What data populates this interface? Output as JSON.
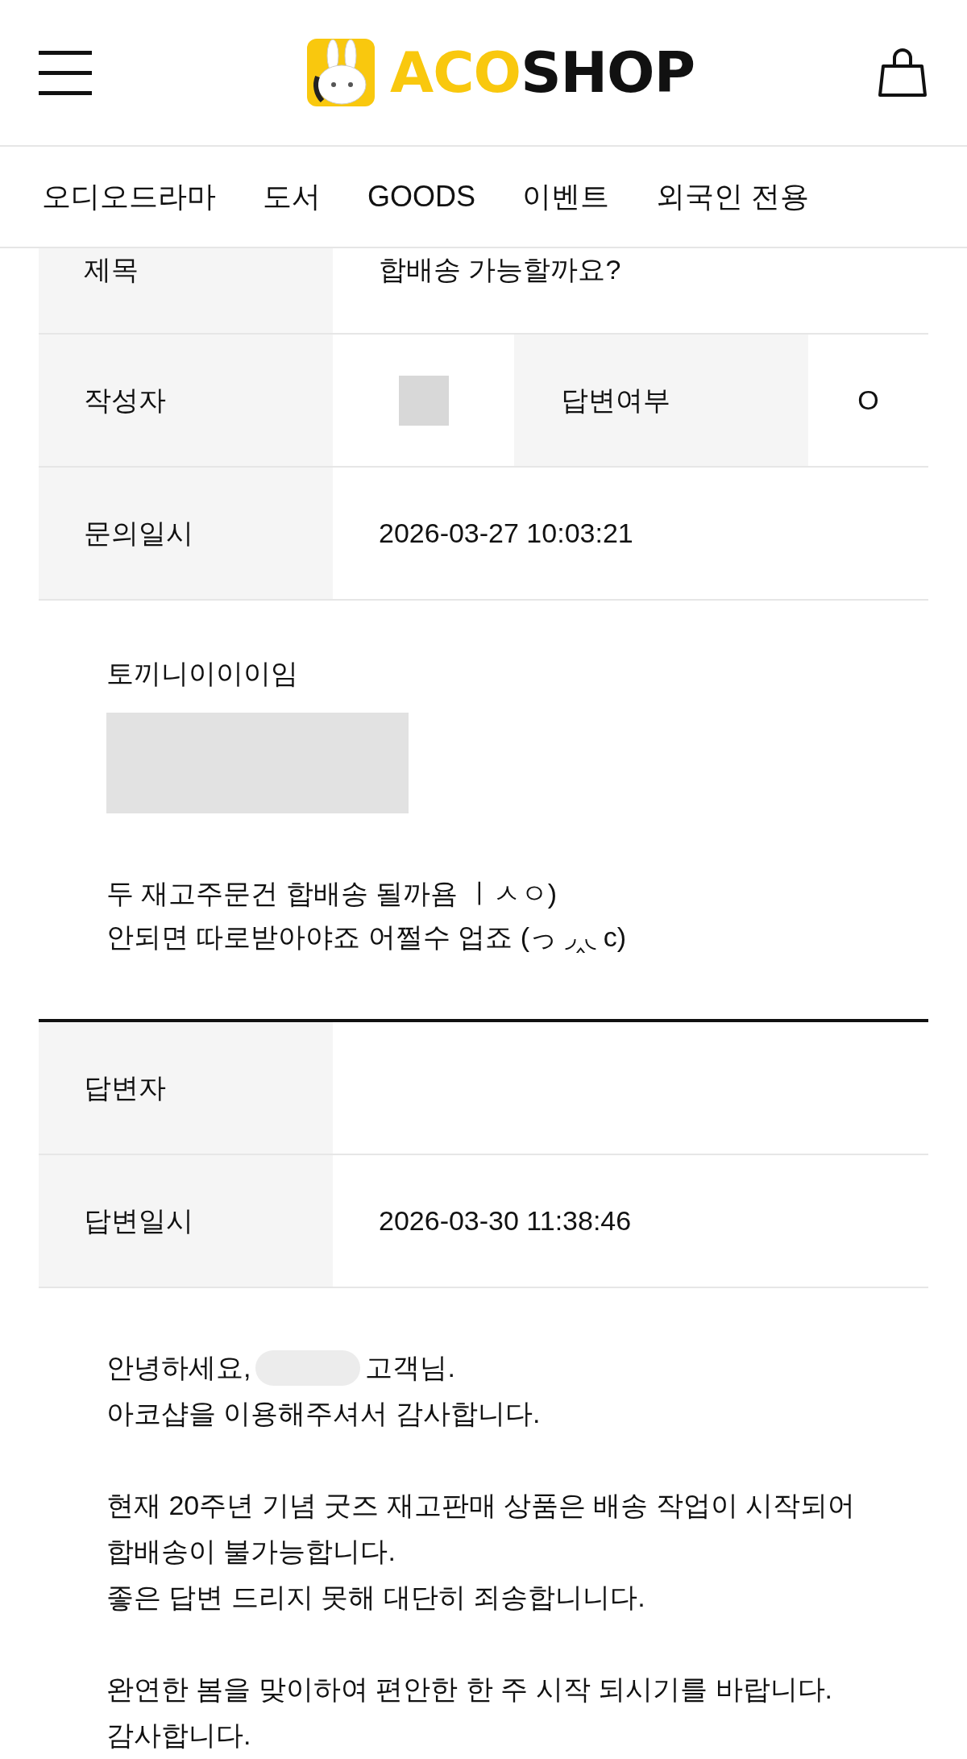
{
  "header": {
    "logo": {
      "accent": "ACO",
      "rest": "SHOP"
    }
  },
  "nav": [
    {
      "label": "오디오드라마"
    },
    {
      "label": "도서"
    },
    {
      "label": "GOODS"
    },
    {
      "label": "이벤트"
    },
    {
      "label": "외국인 전용"
    }
  ],
  "question": {
    "rows": [
      {
        "kind": "text",
        "label": "제목",
        "value": "합배송 가능할까요?",
        "cut": true
      },
      {
        "kind": "pair",
        "label": "작성자",
        "redacted": true,
        "label_2": "답변여부",
        "value_2": "O"
      },
      {
        "kind": "text",
        "label": "문의일시",
        "value": "2026-03-27 10:03:21"
      }
    ],
    "body": [
      {
        "kind": "text",
        "text": "토끼니이이이임"
      },
      {
        "kind": "redacted"
      },
      {
        "kind": "lines",
        "lines": [
          "두 재고주문건 합배송 될까욤 ㅣㅅㅇ)",
          "안되면 따로받아야죠 어쩔수 업죠 (っ ◞‸◟ c)"
        ]
      }
    ]
  },
  "answer": {
    "rows": [
      {
        "label": "답변자"
      },
      {
        "label": "답변일시",
        "value": "2026-03-30 11:38:46"
      }
    ],
    "paragraphs": [
      [
        {
          "text": "안녕하세요,",
          "redacted": true,
          "text_2": "고객님."
        },
        {
          "text": "아코샵을 이용해주셔서 감사합니다."
        }
      ],
      [
        {
          "text": "현재 20주년 기념 굿즈 재고판매 상품은 배송 작업이 시작되어"
        },
        {
          "text": "합배송이 불가능합니다."
        },
        {
          "text": "좋은 답변 드리지 못해 대단히 죄송합니니다."
        }
      ],
      [
        {
          "text": "완연한 봄을 맞이하여 편안한 한 주 시작 되시기를 바랍니다."
        },
        {
          "text": "감사합니다."
        }
      ]
    ]
  }
}
